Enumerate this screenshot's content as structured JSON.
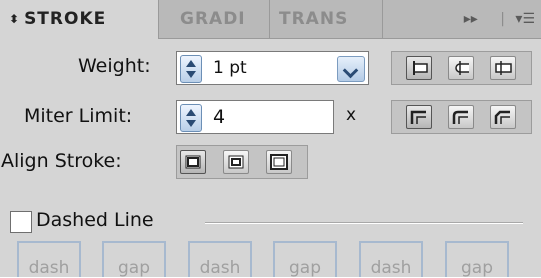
{
  "tabs": [
    {
      "label": "STROKE",
      "active": true,
      "icon": "collapse-arrows-icon"
    },
    {
      "label": "GRADI",
      "active": false
    },
    {
      "label": "TRANS",
      "active": false
    }
  ],
  "panel_menu": {
    "forward_label": "▸▸",
    "menu_icon": "panel-menu-icon"
  },
  "weight": {
    "label": "Weight:",
    "value": "1 pt"
  },
  "miter": {
    "label": "Miter Limit:",
    "value": "4",
    "suffix": "x"
  },
  "align": {
    "label": "Align Stroke:"
  },
  "dashed": {
    "label": "Dashed Line",
    "checked": false
  },
  "dash_fields": [
    "dash",
    "gap",
    "dash",
    "gap",
    "dash",
    "gap"
  ],
  "colors": {
    "accent": "#6c8fb6",
    "panel_bg": "#d5d5d5",
    "tab_bg": "#b9b9b9"
  }
}
